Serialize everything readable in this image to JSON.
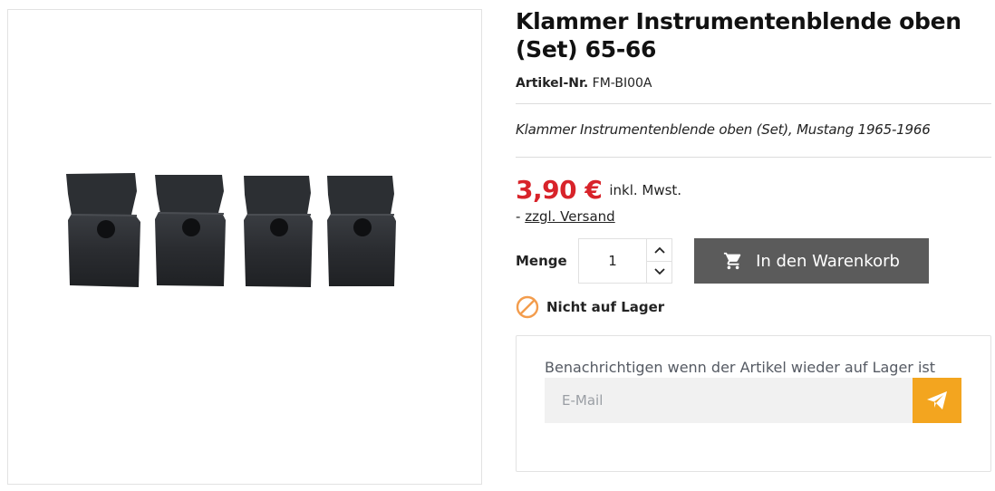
{
  "product": {
    "title": "Klammer Instrumentenblende oben (Set) 65-66",
    "reference_label": "Artikel-Nr.",
    "reference_value": "FM-BI00A",
    "short_description": "Klammer Instrumentenblende oben (Set), Mustang 1965-1966",
    "image_icon": "clips-product-photo"
  },
  "price": {
    "amount": "3,90 €",
    "tax_label": "inkl. Mwst.",
    "shipping_prefix": "-",
    "shipping_link": "zzgl. Versand"
  },
  "cart": {
    "quantity_label": "Menge",
    "quantity_value": "1",
    "add_to_cart_label": "In den Warenkorb",
    "button_color": "#5b5b5b"
  },
  "availability": {
    "status_text": "Nicht auf Lager",
    "icon": "ban-icon",
    "icon_color": "#f39c4c"
  },
  "notify": {
    "message": "Benachrichtigen wenn der Artikel wieder auf Lager ist",
    "email_placeholder": "E-Mail",
    "send_icon": "paper-plane-icon",
    "send_color": "#f3a51f"
  },
  "colors": {
    "price": "#d8232a",
    "text": "#232323"
  }
}
